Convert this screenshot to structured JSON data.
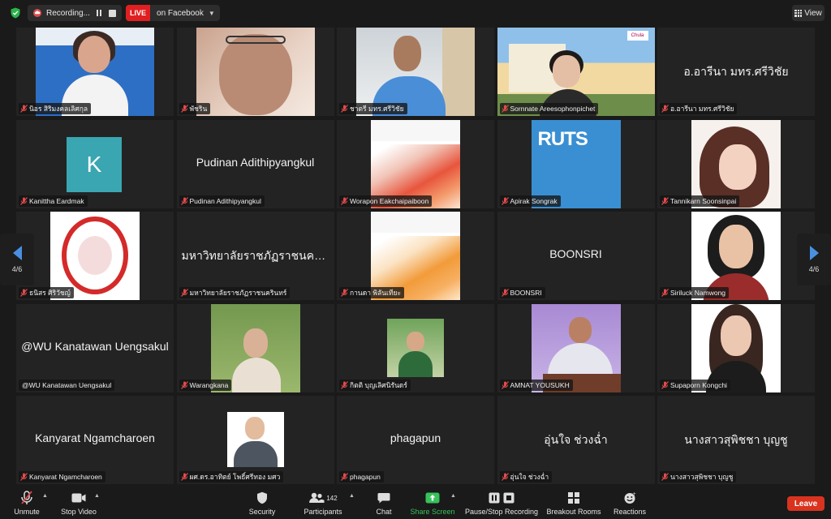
{
  "topbar": {
    "recording_label": "Recording...",
    "live_badge": "LIVE",
    "live_target": "on Facebook",
    "view_label": "View"
  },
  "gallery": {
    "tiles": [
      {
        "label": "นิอร สิริมงคลเลิศกุล",
        "big_name": ""
      },
      {
        "label": "พัชริน",
        "big_name": ""
      },
      {
        "label": "ชาตรี มทร.ศรีวิชัย",
        "big_name": ""
      },
      {
        "label": "Sornnate Areesophonpichet",
        "big_name": "",
        "logo": "Chula"
      },
      {
        "label": "อ.อารีนา มทร.ศรีวิชัย",
        "big_name": "อ.อารีนา มทร.ศรีวิชัย"
      },
      {
        "label": "Kanittha Eardmak",
        "big_name": "",
        "avatar_letter": "K"
      },
      {
        "label": "Pudinan Adithipyangkul",
        "big_name": "Pudinan Adithipyangkul"
      },
      {
        "label": "Worapon Eakchaipaiboon",
        "big_name": ""
      },
      {
        "label": "Apirak Songrak",
        "big_name": "",
        "logo": "RUTS"
      },
      {
        "label": "Tannikarn Soonsinpai",
        "big_name": ""
      },
      {
        "label": "ธนิสร ศิริวัชญ์",
        "big_name": ""
      },
      {
        "label": "มหาวิทยาลัยราชภัฏราชนครินทร์",
        "big_name": "มหาวิทยาลัยราชภัฏราชนคริ..."
      },
      {
        "label": "กานดา พิลันเทียะ",
        "big_name": ""
      },
      {
        "label": "BOONSRI",
        "big_name": "BOONSRI"
      },
      {
        "label": "Siriluck Namwong",
        "big_name": ""
      },
      {
        "label": "@WU Kanatawan Uengsakul",
        "big_name": "@WU Kanatawan Uengsakul"
      },
      {
        "label": "Warangkana",
        "big_name": ""
      },
      {
        "label": "กิตติ บุญเลิศนิรันดร์",
        "big_name": ""
      },
      {
        "label": "AMNAT YOUSUKH",
        "big_name": ""
      },
      {
        "label": "Supaporn Kongchi",
        "big_name": ""
      },
      {
        "label": "Kanyarat Ngamcharoen",
        "big_name": "Kanyarat Ngamcharoen"
      },
      {
        "label": "ผศ.ดร.อาทิตย์ โพธิ์ศรีทอง มศว",
        "big_name": ""
      },
      {
        "label": "phagapun",
        "big_name": "phagapun"
      },
      {
        "label": "อุ่นใจ ช่วงฉ่ำ",
        "big_name": "อุ่นใจ  ช่วงฉ่ำ"
      },
      {
        "label": "นางสาวสุพิชชา บุญชู",
        "big_name": "นางสาวสุพิชชา  บุญชู"
      }
    ]
  },
  "nav": {
    "left_page": "4/6",
    "right_page": "4/6"
  },
  "toolbar": {
    "unmute": "Unmute",
    "stop_video": "Stop Video",
    "security": "Security",
    "participants": "Participants",
    "participant_count": "142",
    "chat": "Chat",
    "share_screen": "Share Screen",
    "pause_stop_recording": "Pause/Stop Recording",
    "breakout_rooms": "Breakout Rooms",
    "reactions": "Reactions",
    "leave": "Leave"
  },
  "colors": {
    "live": "#e02020",
    "share": "#37c25a",
    "leave": "#d9331f",
    "nav_arrow": "#4a90e2"
  }
}
